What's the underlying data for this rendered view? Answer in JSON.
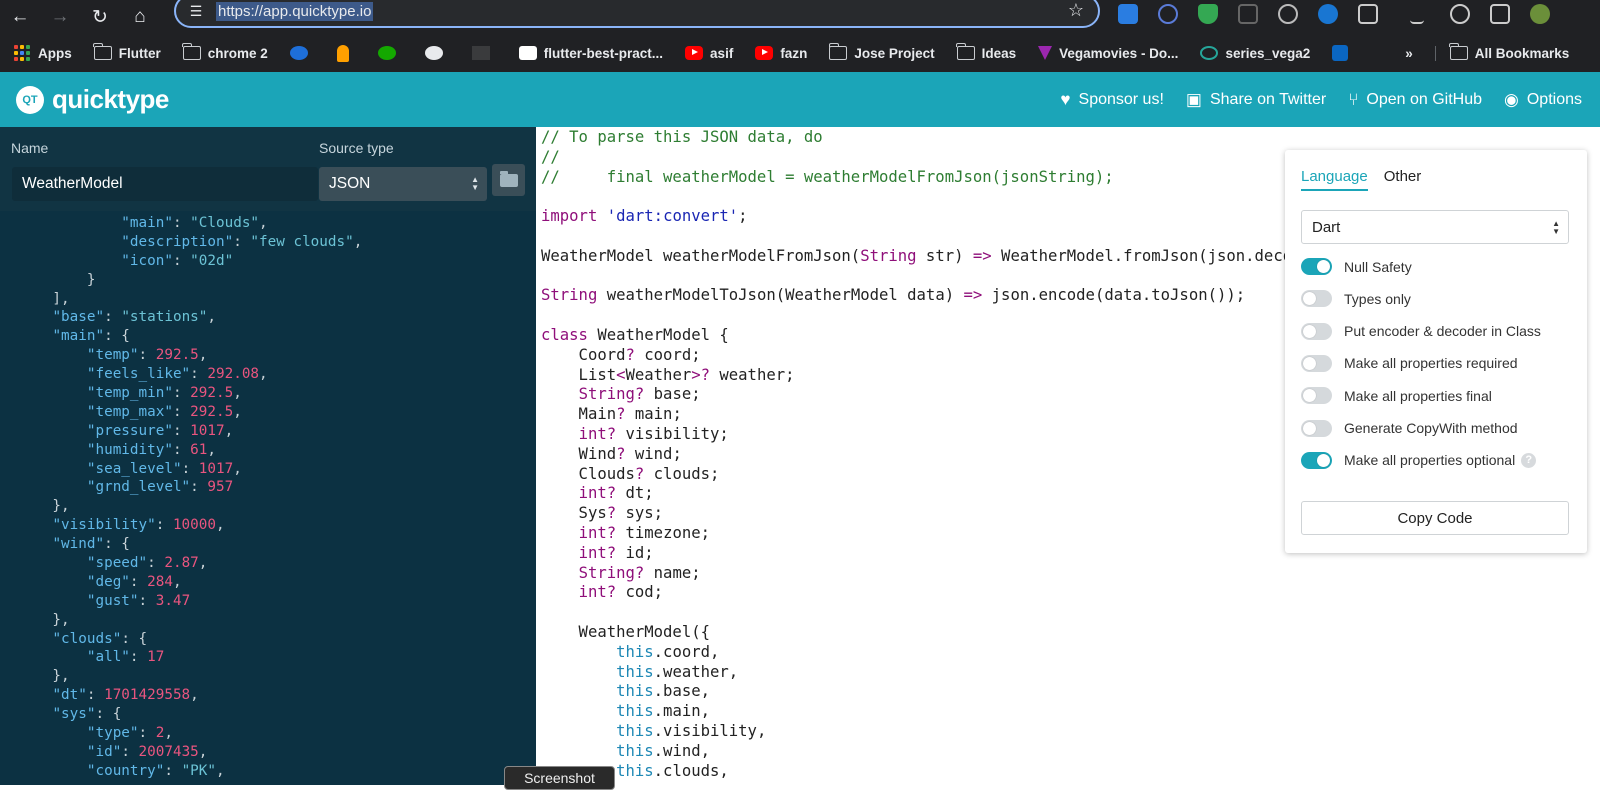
{
  "browser": {
    "url": "https://app.quicktype.io",
    "bookmarks": [
      {
        "label": "Apps",
        "icon": "apps-grid-icon"
      },
      {
        "label": "Flutter",
        "icon": "folder-icon"
      },
      {
        "label": "chrome 2",
        "icon": "folder-icon"
      },
      {
        "label": "",
        "icon": "circle-4-icon"
      },
      {
        "label": "",
        "icon": "firebase-icon"
      },
      {
        "label": "",
        "icon": "upwork-icon"
      },
      {
        "label": "",
        "icon": "github-icon"
      },
      {
        "label": "",
        "icon": "bookmark-icon"
      },
      {
        "label": "flutter-best-pract...",
        "icon": "medium-icon"
      },
      {
        "label": "asif",
        "icon": "youtube-icon"
      },
      {
        "label": "fazn",
        "icon": "youtube-icon"
      },
      {
        "label": "Jose Project",
        "icon": "folder-icon"
      },
      {
        "label": "Ideas",
        "icon": "folder-icon"
      },
      {
        "label": "Vegamovies - Do...",
        "icon": "vegamovies-icon"
      },
      {
        "label": "series_vega2",
        "icon": "taurus-icon"
      },
      {
        "label": "",
        "icon": "linkedin-icon"
      }
    ],
    "more_label": "»",
    "all_bookmarks": "All Bookmarks"
  },
  "app": {
    "logo_badge": "QT",
    "logo_text": "quicktype",
    "nav": [
      {
        "label": "Sponsor us!",
        "icon": "heart-icon"
      },
      {
        "label": "Share on Twitter",
        "icon": "chat-icon"
      },
      {
        "label": "Open on GitHub",
        "icon": "branch-icon"
      },
      {
        "label": "Options",
        "icon": "eye-icon"
      }
    ]
  },
  "left": {
    "name_label": "Name",
    "name_value": "WeatherModel",
    "source_label": "Source type",
    "source_value": "JSON",
    "json_lines": [
      [
        [
          "",
          "            "
        ],
        [
          "k",
          "\"main\""
        ],
        [
          "",
          ": "
        ],
        [
          "s",
          "\"Clouds\""
        ],
        [
          "",
          ","
        ]
      ],
      [
        [
          "",
          "            "
        ],
        [
          "k",
          "\"description\""
        ],
        [
          "",
          ": "
        ],
        [
          "s",
          "\"few clouds\""
        ],
        [
          "",
          ","
        ]
      ],
      [
        [
          "",
          "            "
        ],
        [
          "k",
          "\"icon\""
        ],
        [
          "",
          ": "
        ],
        [
          "s",
          "\"02d\""
        ]
      ],
      [
        [
          "",
          "        }"
        ]
      ],
      [
        [
          "",
          "    ],"
        ]
      ],
      [
        [
          "",
          "    "
        ],
        [
          "k",
          "\"base\""
        ],
        [
          "",
          ": "
        ],
        [
          "s",
          "\"stations\""
        ],
        [
          "",
          ","
        ]
      ],
      [
        [
          "",
          "    "
        ],
        [
          "k",
          "\"main\""
        ],
        [
          "",
          ": {"
        ]
      ],
      [
        [
          "",
          "        "
        ],
        [
          "k",
          "\"temp\""
        ],
        [
          "",
          ": "
        ],
        [
          "n",
          "292.5"
        ],
        [
          "",
          ","
        ]
      ],
      [
        [
          "",
          "        "
        ],
        [
          "k",
          "\"feels_like\""
        ],
        [
          "",
          ": "
        ],
        [
          "n",
          "292.08"
        ],
        [
          "",
          ","
        ]
      ],
      [
        [
          "",
          "        "
        ],
        [
          "k",
          "\"temp_min\""
        ],
        [
          "",
          ": "
        ],
        [
          "n",
          "292.5"
        ],
        [
          "",
          ","
        ]
      ],
      [
        [
          "",
          "        "
        ],
        [
          "k",
          "\"temp_max\""
        ],
        [
          "",
          ": "
        ],
        [
          "n",
          "292.5"
        ],
        [
          "",
          ","
        ]
      ],
      [
        [
          "",
          "        "
        ],
        [
          "k",
          "\"pressure\""
        ],
        [
          "",
          ": "
        ],
        [
          "n",
          "1017"
        ],
        [
          "",
          ","
        ]
      ],
      [
        [
          "",
          "        "
        ],
        [
          "k",
          "\"humidity\""
        ],
        [
          "",
          ": "
        ],
        [
          "n",
          "61"
        ],
        [
          "",
          ","
        ]
      ],
      [
        [
          "",
          "        "
        ],
        [
          "k",
          "\"sea_level\""
        ],
        [
          "",
          ": "
        ],
        [
          "n",
          "1017"
        ],
        [
          "",
          ","
        ]
      ],
      [
        [
          "",
          "        "
        ],
        [
          "k",
          "\"grnd_level\""
        ],
        [
          "",
          ": "
        ],
        [
          "n",
          "957"
        ]
      ],
      [
        [
          "",
          "    },"
        ]
      ],
      [
        [
          "",
          "    "
        ],
        [
          "k",
          "\"visibility\""
        ],
        [
          "",
          ": "
        ],
        [
          "n",
          "10000"
        ],
        [
          "",
          ","
        ]
      ],
      [
        [
          "",
          "    "
        ],
        [
          "k",
          "\"wind\""
        ],
        [
          "",
          ": {"
        ]
      ],
      [
        [
          "",
          "        "
        ],
        [
          "k",
          "\"speed\""
        ],
        [
          "",
          ": "
        ],
        [
          "n",
          "2.87"
        ],
        [
          "",
          ","
        ]
      ],
      [
        [
          "",
          "        "
        ],
        [
          "k",
          "\"deg\""
        ],
        [
          "",
          ": "
        ],
        [
          "n",
          "284"
        ],
        [
          "",
          ","
        ]
      ],
      [
        [
          "",
          "        "
        ],
        [
          "k",
          "\"gust\""
        ],
        [
          "",
          ": "
        ],
        [
          "n",
          "3.47"
        ]
      ],
      [
        [
          "",
          "    },"
        ]
      ],
      [
        [
          "",
          "    "
        ],
        [
          "k",
          "\"clouds\""
        ],
        [
          "",
          ": {"
        ]
      ],
      [
        [
          "",
          "        "
        ],
        [
          "k",
          "\"all\""
        ],
        [
          "",
          ": "
        ],
        [
          "n",
          "17"
        ]
      ],
      [
        [
          "",
          "    },"
        ]
      ],
      [
        [
          "",
          "    "
        ],
        [
          "k",
          "\"dt\""
        ],
        [
          "",
          ": "
        ],
        [
          "n",
          "1701429558"
        ],
        [
          "",
          ","
        ]
      ],
      [
        [
          "",
          "    "
        ],
        [
          "k",
          "\"sys\""
        ],
        [
          "",
          ": {"
        ]
      ],
      [
        [
          "",
          "        "
        ],
        [
          "k",
          "\"type\""
        ],
        [
          "",
          ": "
        ],
        [
          "n",
          "2"
        ],
        [
          "",
          ","
        ]
      ],
      [
        [
          "",
          "        "
        ],
        [
          "k",
          "\"id\""
        ],
        [
          "",
          ": "
        ],
        [
          "n",
          "2007435"
        ],
        [
          "",
          ","
        ]
      ],
      [
        [
          "",
          "        "
        ],
        [
          "k",
          "\"country\""
        ],
        [
          "",
          ": "
        ],
        [
          "s",
          "\"PK\""
        ],
        [
          "",
          ","
        ]
      ]
    ]
  },
  "code": {
    "lines": [
      [
        [
          "c",
          "// To parse this JSON data, do"
        ]
      ],
      [
        [
          "c",
          "//"
        ]
      ],
      [
        [
          "c",
          "//     final weatherModel = weatherModelFromJson(jsonString);"
        ]
      ],
      [
        [
          "",
          ""
        ]
      ],
      [
        [
          "kw",
          "import"
        ],
        [
          "",
          " "
        ],
        [
          "str",
          "'dart:convert'"
        ],
        [
          "",
          ";"
        ]
      ],
      [
        [
          "",
          ""
        ]
      ],
      [
        [
          "",
          "WeatherModel weatherModelFromJson("
        ],
        [
          "kw",
          "String"
        ],
        [
          "",
          " str) "
        ],
        [
          "kw",
          "=>"
        ],
        [
          "",
          " WeatherModel.fromJson(json.decode(str));"
        ]
      ],
      [
        [
          "",
          ""
        ]
      ],
      [
        [
          "kw",
          "String"
        ],
        [
          "",
          " weatherModelToJson(WeatherModel data) "
        ],
        [
          "kw",
          "=>"
        ],
        [
          "",
          " json.encode(data.toJson());"
        ]
      ],
      [
        [
          "",
          ""
        ]
      ],
      [
        [
          "kw",
          "class"
        ],
        [
          "",
          " WeatherModel {"
        ]
      ],
      [
        [
          "",
          "    Coord"
        ],
        [
          "kw",
          "?"
        ],
        [
          "",
          " coord;"
        ]
      ],
      [
        [
          "",
          "    List"
        ],
        [
          "kw",
          "<"
        ],
        [
          "",
          "Weather"
        ],
        [
          "kw",
          ">?"
        ],
        [
          "",
          " weather;"
        ]
      ],
      [
        [
          "",
          "    "
        ],
        [
          "kw",
          "String?"
        ],
        [
          "",
          " base;"
        ]
      ],
      [
        [
          "",
          "    Main"
        ],
        [
          "kw",
          "?"
        ],
        [
          "",
          " main;"
        ]
      ],
      [
        [
          "",
          "    "
        ],
        [
          "kw",
          "int?"
        ],
        [
          "",
          " visibility;"
        ]
      ],
      [
        [
          "",
          "    Wind"
        ],
        [
          "kw",
          "?"
        ],
        [
          "",
          " wind;"
        ]
      ],
      [
        [
          "",
          "    Clouds"
        ],
        [
          "kw",
          "?"
        ],
        [
          "",
          " clouds;"
        ]
      ],
      [
        [
          "",
          "    "
        ],
        [
          "kw",
          "int?"
        ],
        [
          "",
          " dt;"
        ]
      ],
      [
        [
          "",
          "    Sys"
        ],
        [
          "kw",
          "?"
        ],
        [
          "",
          " sys;"
        ]
      ],
      [
        [
          "",
          "    "
        ],
        [
          "kw",
          "int?"
        ],
        [
          "",
          " timezone;"
        ]
      ],
      [
        [
          "",
          "    "
        ],
        [
          "kw",
          "int?"
        ],
        [
          "",
          " id;"
        ]
      ],
      [
        [
          "",
          "    "
        ],
        [
          "kw",
          "String?"
        ],
        [
          "",
          " name;"
        ]
      ],
      [
        [
          "",
          "    "
        ],
        [
          "kw",
          "int?"
        ],
        [
          "",
          " cod;"
        ]
      ],
      [
        [
          "",
          ""
        ]
      ],
      [
        [
          "",
          "    WeatherModel({"
        ]
      ],
      [
        [
          "",
          "        "
        ],
        [
          "this",
          "this"
        ],
        [
          "",
          ".coord,"
        ]
      ],
      [
        [
          "",
          "        "
        ],
        [
          "this",
          "this"
        ],
        [
          "",
          ".weather,"
        ]
      ],
      [
        [
          "",
          "        "
        ],
        [
          "this",
          "this"
        ],
        [
          "",
          ".base,"
        ]
      ],
      [
        [
          "",
          "        "
        ],
        [
          "this",
          "this"
        ],
        [
          "",
          ".main,"
        ]
      ],
      [
        [
          "",
          "        "
        ],
        [
          "this",
          "this"
        ],
        [
          "",
          ".visibility,"
        ]
      ],
      [
        [
          "",
          "        "
        ],
        [
          "this",
          "this"
        ],
        [
          "",
          ".wind,"
        ]
      ],
      [
        [
          "",
          "        "
        ],
        [
          "this",
          "this"
        ],
        [
          "",
          ".clouds,"
        ]
      ]
    ]
  },
  "options": {
    "tab_language": "Language",
    "tab_other": "Other",
    "language_value": "Dart",
    "toggles": [
      {
        "label": "Null Safety",
        "on": true
      },
      {
        "label": "Types only",
        "on": false
      },
      {
        "label": "Put encoder & decoder in Class",
        "on": false
      },
      {
        "label": "Make all properties required",
        "on": false
      },
      {
        "label": "Make all properties final",
        "on": false
      },
      {
        "label": "Generate CopyWith method",
        "on": false
      },
      {
        "label": "Make all properties optional",
        "on": true,
        "help": "?"
      }
    ],
    "copy_label": "Copy Code"
  },
  "tooltip": "Screenshot",
  "colors": {
    "accent": "#1ba5b8",
    "left_bg": "#0c3142",
    "number": "#e9557f"
  }
}
